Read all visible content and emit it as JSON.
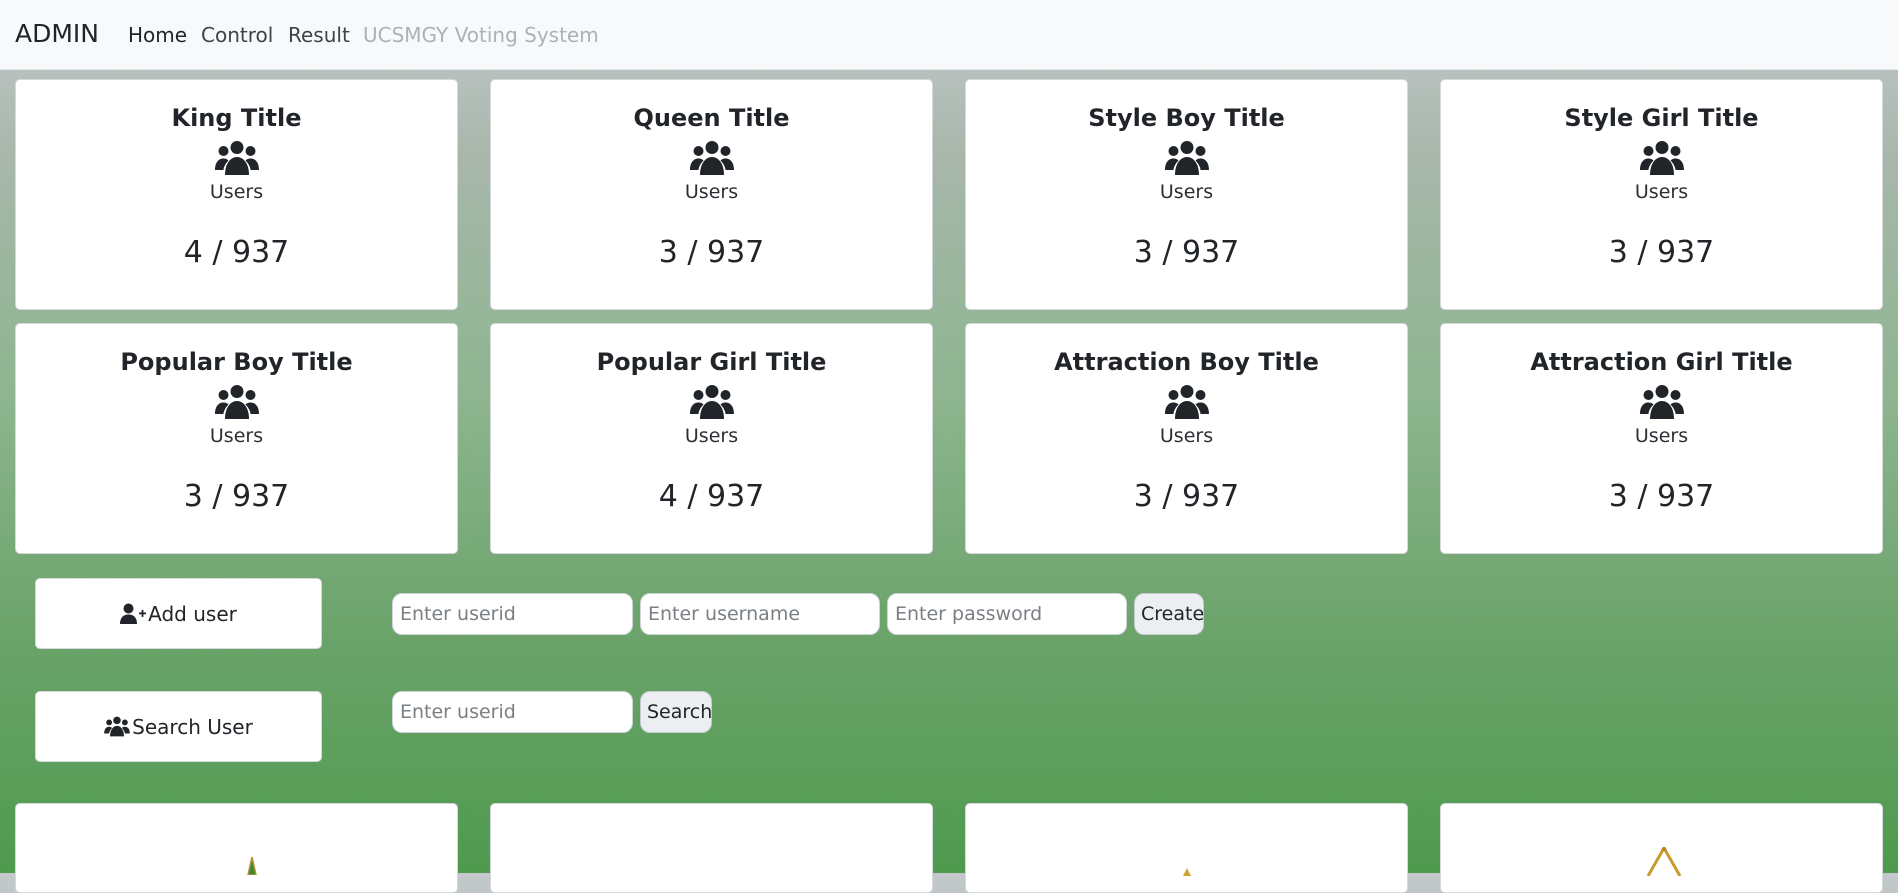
{
  "navbar": {
    "brand": "ADMIN",
    "links": [
      {
        "label": "Home"
      },
      {
        "label": "Control"
      },
      {
        "label": "Result"
      },
      {
        "label": "UCSMGY Voting System"
      }
    ]
  },
  "titles": [
    {
      "title": "King Title",
      "users_label": "Users",
      "count": "4 / 937"
    },
    {
      "title": "Queen Title",
      "users_label": "Users",
      "count": "3 / 937"
    },
    {
      "title": "Style Boy Title",
      "users_label": "Users",
      "count": "3 / 937"
    },
    {
      "title": "Style Girl Title",
      "users_label": "Users",
      "count": "3 / 937"
    },
    {
      "title": "Popular Boy Title",
      "users_label": "Users",
      "count": "3 / 937"
    },
    {
      "title": "Popular Girl Title",
      "users_label": "Users",
      "count": "4 / 937"
    },
    {
      "title": "Attraction Boy Title",
      "users_label": "Users",
      "count": "3 / 937"
    },
    {
      "title": "Attraction Girl Title",
      "users_label": "Users",
      "count": "3 / 937"
    }
  ],
  "add_user": {
    "button_label": "Add user",
    "userid_placeholder": "Enter userid",
    "username_placeholder": "Enter username",
    "password_placeholder": "Enter password",
    "create_label": "Create"
  },
  "search_user": {
    "button_label": "Search User",
    "userid_placeholder": "Enter userid",
    "search_label": "Search"
  },
  "icons": {
    "users": "users-icon",
    "user_plus": "user-plus-icon"
  },
  "colors": {
    "navbar_bg": "#f8f9fa",
    "gradient_top": "#c4c9cc",
    "gradient_bottom": "#4f9a4f",
    "disabled_link": "#aeb1b4"
  }
}
